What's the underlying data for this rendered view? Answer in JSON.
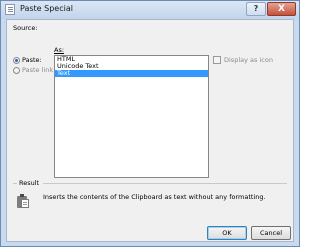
{
  "window": {
    "title": "Paste Special",
    "help_glyph": "?",
    "close_glyph": "X"
  },
  "source": {
    "label": "Source:"
  },
  "as": {
    "label": "As:"
  },
  "paste_options": [
    {
      "label": "Paste:",
      "checked": true
    },
    {
      "label": "Paste link:",
      "checked": false
    }
  ],
  "formats": [
    "HTML",
    "Unicode Text",
    "Text"
  ],
  "selected_format": "Text",
  "display_as_icon": {
    "label": "Display as icon",
    "checked": false
  },
  "result": {
    "label": "Result",
    "description": "Inserts the contents of the Clipboard as text without any formatting."
  },
  "buttons": {
    "ok": "OK",
    "cancel": "Cancel"
  }
}
